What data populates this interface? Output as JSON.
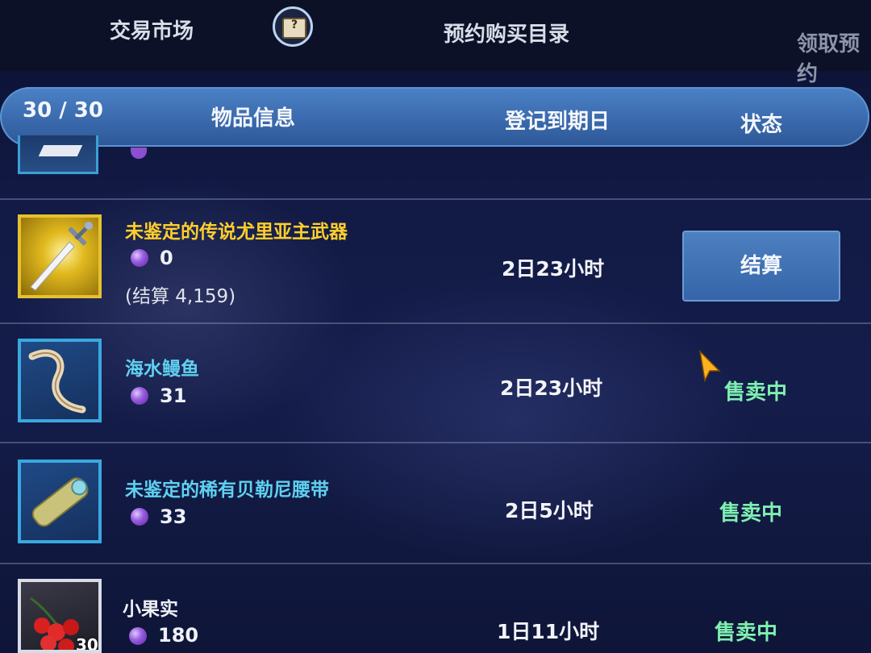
{
  "top_tabs": {
    "market": "交易市场",
    "guide_icon": "book-question-icon",
    "guide_glyph": "?",
    "reserve_list": "预约购买目录",
    "receive": "领取预约"
  },
  "table_header": {
    "count": "30 / 30",
    "item_info": "物品信息",
    "expiry": "登记到期日",
    "status": "状态"
  },
  "items": [
    {
      "name": "未鉴定的传说尤里亚主武器",
      "icon": "sword-icon",
      "price": "0",
      "settle_note": "(结算 4,159)",
      "expiry": "2日23小时",
      "action_label": "结算"
    },
    {
      "name": "海水鳗鱼",
      "icon": "eel-icon",
      "price": "31",
      "expiry": "2日23小时",
      "status": "售卖中"
    },
    {
      "name": "未鉴定的稀有贝勒尼腰带",
      "icon": "belt-icon",
      "price": "33",
      "expiry": "2日5小时",
      "status": "售卖中"
    },
    {
      "name": "小果实",
      "icon": "berry-icon",
      "quantity": "30",
      "price": "180",
      "expiry": "1日11小时",
      "status": "售卖中"
    }
  ],
  "colors": {
    "legendary_name": "#ffcf2a",
    "rare_name": "#5fd0f0",
    "selling_status": "#7ff0b0",
    "header_bar": "#3a6aad"
  }
}
